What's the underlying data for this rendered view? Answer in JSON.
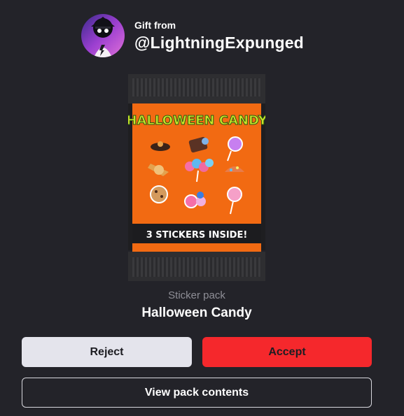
{
  "gift": {
    "from_label": "Gift from",
    "sender": "@LightningExpunged"
  },
  "pack": {
    "title_art": "HALLOWEEN CANDY",
    "banner": "3 STICKERS INSIDE!",
    "type": "Sticker pack",
    "name": "Halloween Candy"
  },
  "actions": {
    "reject": "Reject",
    "accept": "Accept",
    "view_contents": "View pack contents"
  },
  "colors": {
    "background": "#232329",
    "accept": "#f5282c",
    "reject": "#e4e4ec",
    "pack_orange": "#f26a12"
  }
}
